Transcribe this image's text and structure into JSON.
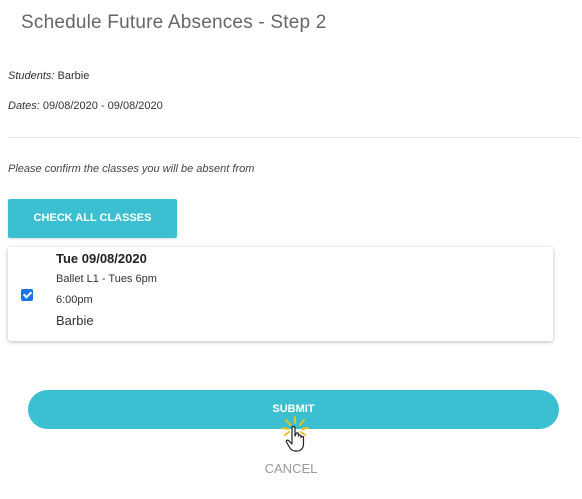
{
  "page": {
    "title": "Schedule Future Absences - Step 2"
  },
  "summary": {
    "students_label": "Students:",
    "students_value": " Barbie",
    "dates_label": "Dates:",
    "dates_value": " 09/08/2020 - 09/08/2020"
  },
  "instructions": "Please confirm the classes you will be absent from",
  "buttons": {
    "check_all": "CHECK ALL CLASSES",
    "submit": "SUBMIT",
    "cancel": "CANCEL"
  },
  "classes": [
    {
      "checked": true,
      "date": "Tue 09/08/2020",
      "name": "Ballet L1 - Tues 6pm",
      "time": "6:00pm",
      "student": "Barbie"
    }
  ],
  "colors": {
    "accent": "#3bbfd1",
    "checkbox": "#1a73e8"
  },
  "icons": {
    "cursor": "hand-pointer-click-icon"
  }
}
